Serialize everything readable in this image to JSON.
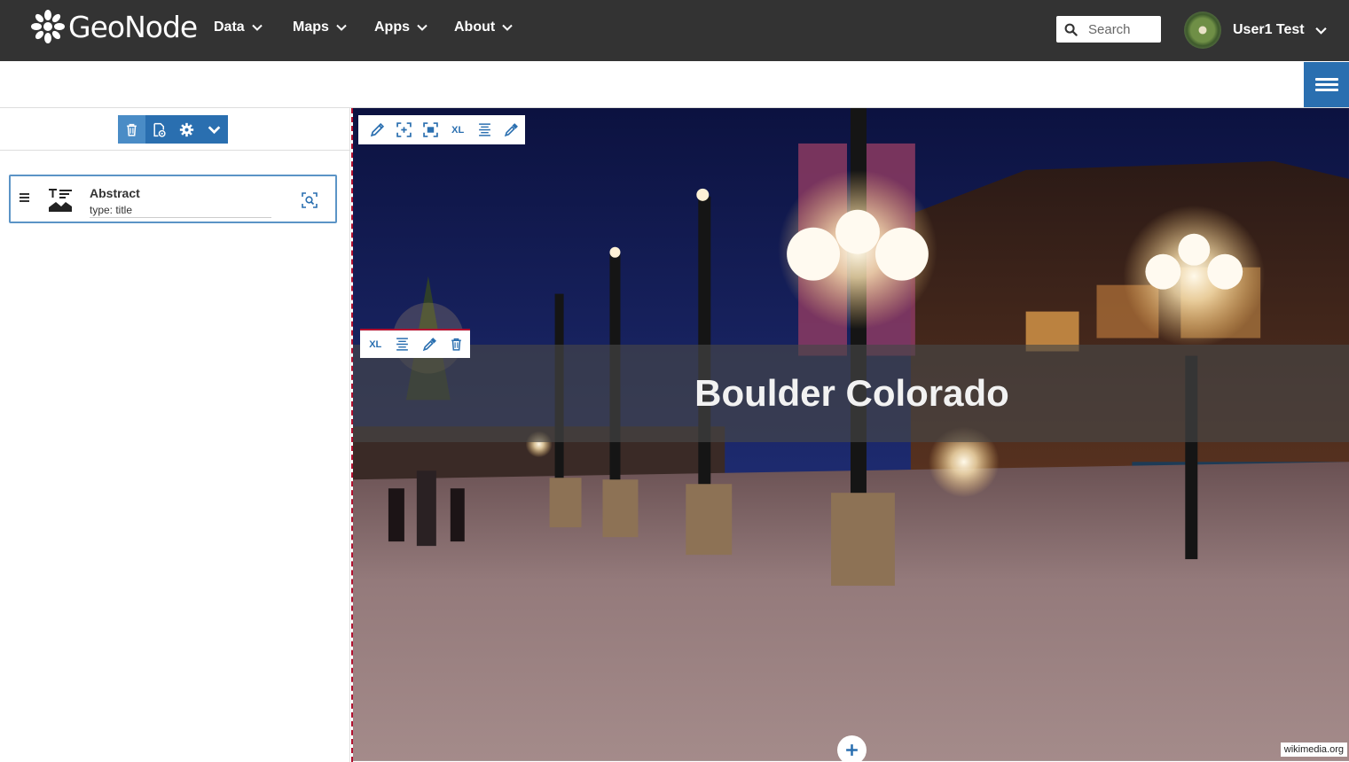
{
  "navbar": {
    "brand": "GeoNode",
    "menu": [
      {
        "label": "Data"
      },
      {
        "label": "Maps"
      },
      {
        "label": "Apps"
      },
      {
        "label": "About"
      }
    ],
    "search_placeholder": "Search",
    "user_name": "User1 Test"
  },
  "left_panel": {
    "toolbar_icons": [
      "trash-icon",
      "preview-icon",
      "gear-icon",
      "chevron-down-icon"
    ],
    "node": {
      "title": "Abstract",
      "type_label": "type: title"
    }
  },
  "canvas": {
    "title_text": "Boulder Colorado",
    "top_toolbar_icons": [
      "pencil-icon",
      "fit-icon",
      "fullscreen-icon",
      "size-xl",
      "align-icon",
      "eyedropper-icon"
    ],
    "mid_toolbar_icons": [
      "size-xl",
      "align-icon",
      "eyedropper-icon",
      "trash-icon"
    ],
    "size_label": "XL",
    "image_credit": "wikimedia.org"
  },
  "colors": {
    "navbar_bg": "#333333",
    "accent": "#2a6fb0",
    "selection_border": "#b2102f"
  }
}
